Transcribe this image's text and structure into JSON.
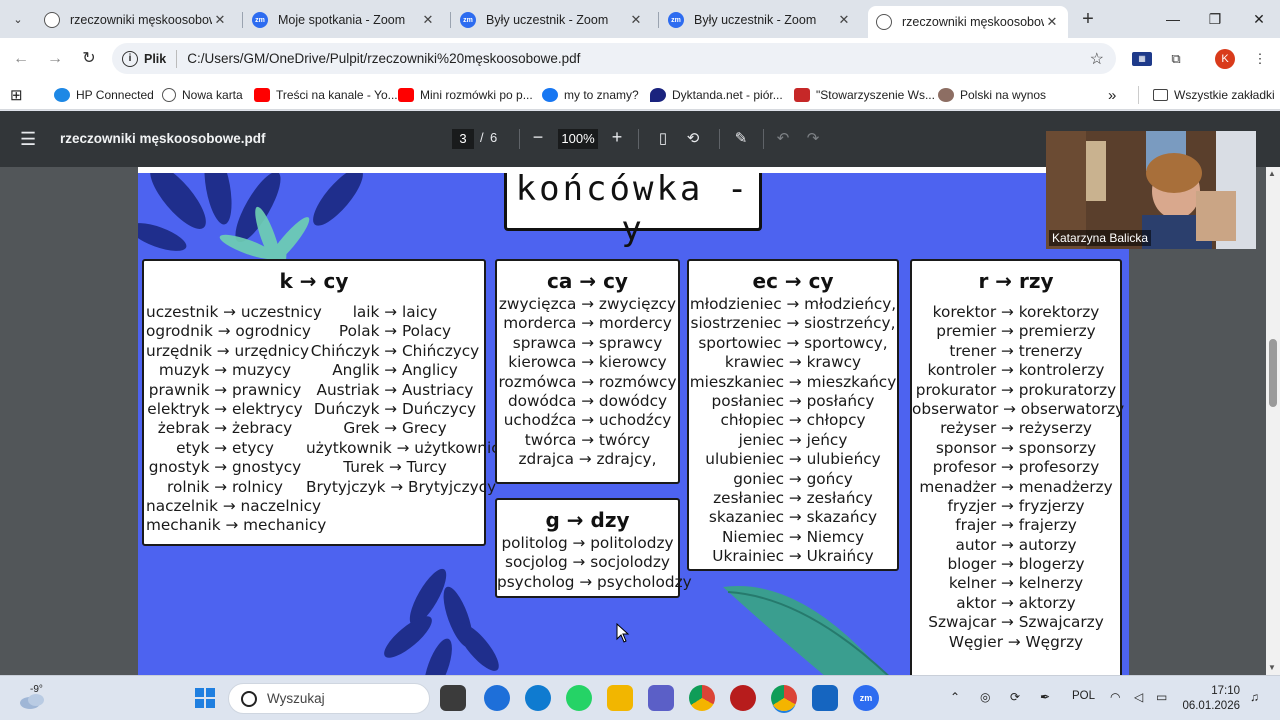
{
  "browser": {
    "tabs": [
      {
        "label": "rzeczowniki męskoosobowe",
        "icon": "globe-icon",
        "active": false
      },
      {
        "label": "Moje spotkania - Zoom",
        "icon": "zoom-icon",
        "active": false
      },
      {
        "label": "Były uczestnik - Zoom",
        "icon": "zoom-icon",
        "active": false
      },
      {
        "label": "Były uczestnik - Zoom",
        "icon": "zoom-icon",
        "active": false
      },
      {
        "label": "rzeczowniki męskoosobowe",
        "icon": "globe-icon",
        "active": true
      }
    ],
    "new_tab": "+",
    "window_controls": {
      "minimize": "—",
      "maximize": "❐",
      "close": "✕"
    },
    "address": {
      "scheme_label": "Plik",
      "url": "C:/Users/GM/OneDrive/Pulpit/rzeczowniki%20męskoosobowe.pdf"
    },
    "profile_initial": "K",
    "bookmarks": [
      {
        "label": "HP Connected",
        "color": "#1e88e5"
      },
      {
        "label": "Nowa karta",
        "color": "#555555"
      },
      {
        "label": "Treści na kanale - Yo...",
        "color": "#ff0000"
      },
      {
        "label": "Mini rozmówki po p...",
        "color": "#ff0000"
      },
      {
        "label": "my to znamy?",
        "color": "#1877f2"
      },
      {
        "label": "Dyktanda.net - piór...",
        "color": "#1a237e"
      },
      {
        "label": "\"Stowarzyszenie Ws...",
        "color": "#c62828"
      },
      {
        "label": "Polski na wynos",
        "color": "#8d6e63"
      }
    ],
    "more_bookmarks": "»",
    "all_bookmarks": "Wszystkie zakładki"
  },
  "pdf": {
    "title": "rzeczowniki męskoosobowe.pdf",
    "page_current": "3",
    "page_separator": "/",
    "page_total": "6",
    "zoom": "100%",
    "heading": "końcówka -y",
    "cards": {
      "k": {
        "title": "k → cy",
        "col1": [
          "uczestnik → uczestnicy",
          "ogrodnik → ogrodnicy",
          "urzędnik → urzędnicy",
          "muzyk → muzycy",
          "prawnik → prawnicy",
          "elektryk → elektrycy",
          "żebrak → żebracy",
          "etyk → etycy",
          "gnostyk → gnostycy",
          "rolnik → rolnicy",
          "naczelnik → naczelnicy",
          "mechanik → mechanicy"
        ],
        "col2": [
          "laik → laicy",
          "Polak → Polacy",
          "Chińczyk → Chińczycy",
          "Anglik → Anglicy",
          "Austriak → Austriacy",
          "Duńczyk → Duńczycy",
          "Grek → Grecy",
          "użytkownik → użytkownicy",
          "Turek → Turcy",
          "Brytyjczyk → Brytyjczycy"
        ]
      },
      "ca": {
        "title": "ca → cy",
        "words": [
          "zwycięzca → zwycięzcy",
          "morderca → mordercy",
          "sprawca → sprawcy",
          "kierowca → kierowcy",
          "rozmówca → rozmówcy",
          "dowódca → dowódcy",
          "uchodźca → uchodźcy",
          "twórca → twórcy",
          "zdrajca → zdrajcy,"
        ]
      },
      "g": {
        "title": "g → dzy",
        "words": [
          "politolog → politolodzy",
          "socjolog → socjolodzy",
          "psycholog → psycholodzy"
        ]
      },
      "ec": {
        "title": "ec → cy",
        "words": [
          "młodzieniec → młodzieńcy,",
          "siostrzeniec → siostrzeńcy,",
          "sportowiec → sportowcy,",
          "krawiec → krawcy",
          "mieszkaniec → mieszkańcy",
          "posłaniec → posłańcy",
          "chłopiec → chłopcy",
          "jeniec → jeńcy",
          "ulubieniec → ulubieńcy",
          "goniec → gońcy",
          "zesłaniec → zesłańcy",
          "skazaniec → skazańcy",
          "Niemiec → Niemcy",
          "Ukrainiec → Ukraińcy"
        ]
      },
      "r": {
        "title": "r → rzy",
        "words": [
          "korektor → korektorzy",
          "premier → premierzy",
          "trener → trenerzy",
          "kontroler → kontrolerzy",
          "prokurator → prokuratorzy",
          "obserwator → obserwatorzy",
          "reżyser → reżyserzy",
          "sponsor → sponsorzy",
          "profesor → profesorzy",
          "menadżer → menadżerzy",
          "fryzjer → fryzjerzy",
          "frajer → frajerzy",
          "autor → autorzy",
          "bloger → blogerzy",
          "kelner → kelnerzy",
          "aktor → aktorzy",
          "Szwajcar → Szwajcarzy",
          "Węgier → Węgrzy"
        ]
      }
    }
  },
  "zoom_tile": {
    "participant_name": "Katarzyna Balicka"
  },
  "taskbar": {
    "temperature": "-9°",
    "search_placeholder": "Wyszukaj",
    "language": "POL",
    "time": "17:10",
    "date": "06.01.2026",
    "app_colors": {
      "explorer": "#f2b600",
      "edge": "#0f7bd0",
      "chrome": "#db4437",
      "zoom": "#2d6cf0",
      "whatsapp": "#25d366",
      "teams": "#5b5fc7"
    }
  }
}
